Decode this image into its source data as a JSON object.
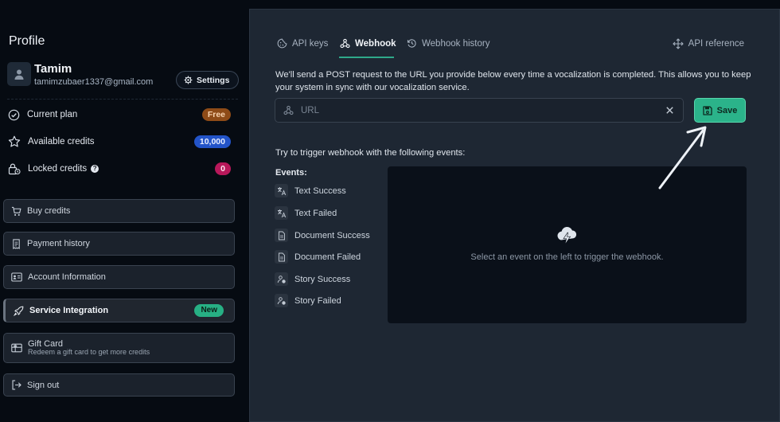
{
  "sidebar": {
    "title": "Profile",
    "user": {
      "name": "Tamim",
      "email": "tamimzubaer1337@gmail.com"
    },
    "settings_label": "Settings",
    "info": [
      {
        "label": "Current plan",
        "badge": "Free"
      },
      {
        "label": "Available credits",
        "badge": "10,000"
      },
      {
        "label": "Locked credits",
        "help": "?",
        "badge": "0"
      }
    ],
    "nav": {
      "buy": "Buy credits",
      "payment": "Payment history",
      "account": "Account Information",
      "integration": "Service Integration",
      "integration_badge": "New",
      "gift_title": "Gift Card",
      "gift_sub": "Redeem a gift card to get more credits",
      "signout": "Sign out"
    }
  },
  "main": {
    "tabs": [
      {
        "label": "API keys",
        "icon": "cookie-icon"
      },
      {
        "label": "Webhook",
        "icon": "webhook-icon",
        "active": true
      },
      {
        "label": "Webhook history",
        "icon": "history-icon"
      }
    ],
    "api_reference": "API reference",
    "description": "We'll send a POST request to the URL you provide below every time a vocalization is completed. This allows you to keep your system in sync with our vocalization service.",
    "url": {
      "value": "",
      "placeholder": "URL"
    },
    "save_label": "Save",
    "trigger_text": "Try to trigger webhook with the following events:",
    "events_label": "Events:",
    "events": [
      {
        "label": "Text Success",
        "icon": "translate-icon"
      },
      {
        "label": "Text Failed",
        "icon": "translate-icon"
      },
      {
        "label": "Document Success",
        "icon": "document-icon"
      },
      {
        "label": "Document Failed",
        "icon": "document-icon"
      },
      {
        "label": "Story Success",
        "icon": "story-icon"
      },
      {
        "label": "Story Failed",
        "icon": "story-icon"
      }
    ],
    "empty_text": "Select an event on the left to trigger the webhook."
  },
  "colors": {
    "accent": "#2bb38a",
    "badge_free": "#8e4b17",
    "badge_credits": "#2354c8",
    "badge_locked": "#b8185a",
    "badge_new": "#27b084"
  }
}
